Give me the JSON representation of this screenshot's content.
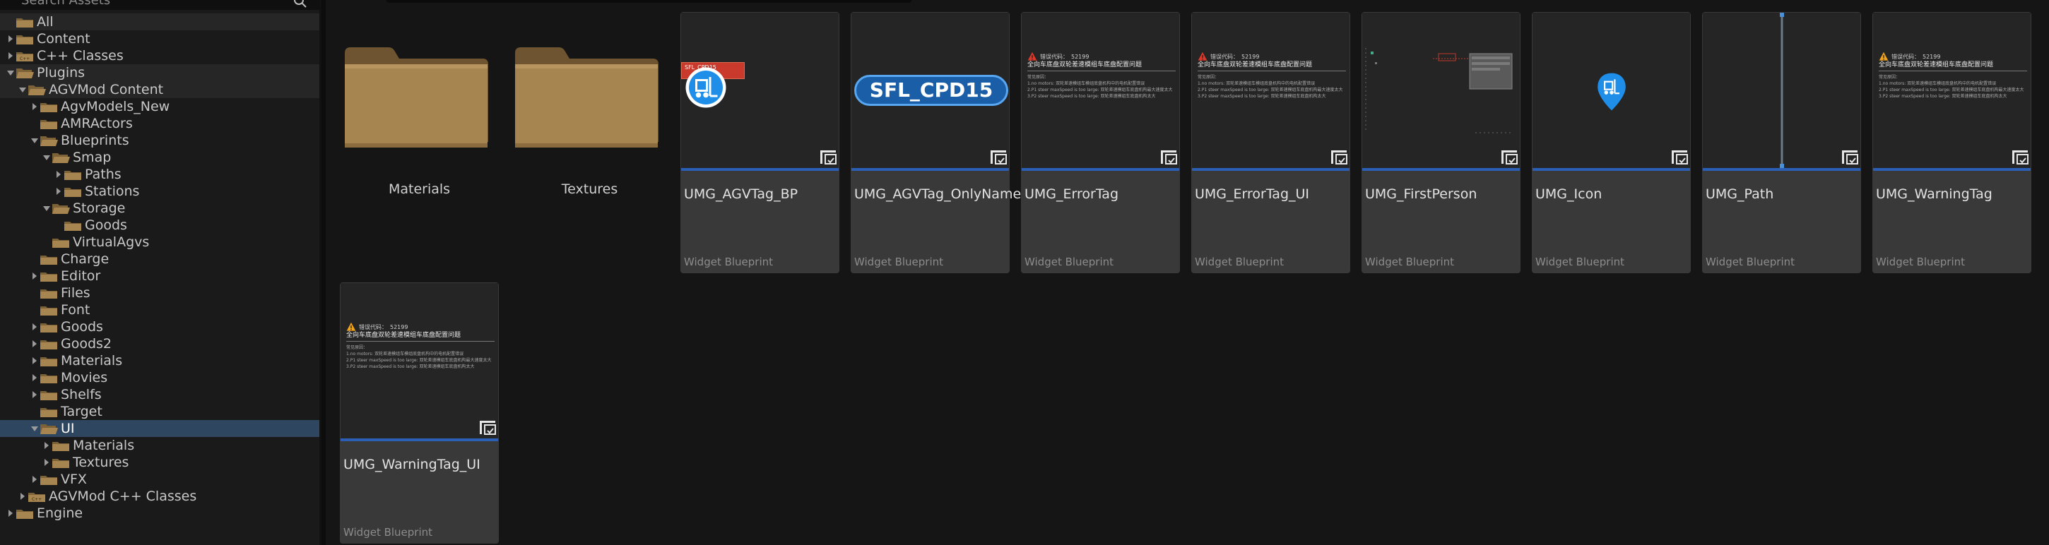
{
  "search": {
    "placeholder": "Search Assets"
  },
  "tree": [
    {
      "label": "All",
      "depth": 0,
      "arrow": "none",
      "state": "hl"
    },
    {
      "label": "Content",
      "depth": 0,
      "arrow": "right",
      "state": ""
    },
    {
      "label": "C++ Classes",
      "depth": 0,
      "arrow": "right",
      "state": "",
      "folder": "cpp"
    },
    {
      "label": "Plugins",
      "depth": 0,
      "arrow": "down",
      "state": "hl"
    },
    {
      "label": "AGVMod Content",
      "depth": 1,
      "arrow": "down",
      "state": "hl"
    },
    {
      "label": "AgvModels_New",
      "depth": 2,
      "arrow": "right",
      "state": ""
    },
    {
      "label": "AMRActors",
      "depth": 2,
      "arrow": "none",
      "state": ""
    },
    {
      "label": "Blueprints",
      "depth": 2,
      "arrow": "down",
      "state": ""
    },
    {
      "label": "Smap",
      "depth": 3,
      "arrow": "down",
      "state": ""
    },
    {
      "label": "Paths",
      "depth": 4,
      "arrow": "right",
      "state": ""
    },
    {
      "label": "Stations",
      "depth": 4,
      "arrow": "right",
      "state": ""
    },
    {
      "label": "Storage",
      "depth": 3,
      "arrow": "down",
      "state": ""
    },
    {
      "label": "Goods",
      "depth": 4,
      "arrow": "none",
      "state": ""
    },
    {
      "label": "VirtualAgvs",
      "depth": 3,
      "arrow": "none",
      "state": ""
    },
    {
      "label": "Charge",
      "depth": 2,
      "arrow": "none",
      "state": ""
    },
    {
      "label": "Editor",
      "depth": 2,
      "arrow": "right",
      "state": ""
    },
    {
      "label": "Files",
      "depth": 2,
      "arrow": "none",
      "state": ""
    },
    {
      "label": "Font",
      "depth": 2,
      "arrow": "none",
      "state": ""
    },
    {
      "label": "Goods",
      "depth": 2,
      "arrow": "right",
      "state": ""
    },
    {
      "label": "Goods2",
      "depth": 2,
      "arrow": "right",
      "state": ""
    },
    {
      "label": "Materials",
      "depth": 2,
      "arrow": "right",
      "state": ""
    },
    {
      "label": "Movies",
      "depth": 2,
      "arrow": "right",
      "state": ""
    },
    {
      "label": "Shelfs",
      "depth": 2,
      "arrow": "right",
      "state": ""
    },
    {
      "label": "Target",
      "depth": 2,
      "arrow": "none",
      "state": ""
    },
    {
      "label": "UI",
      "depth": 2,
      "arrow": "down",
      "state": "sel"
    },
    {
      "label": "Materials",
      "depth": 3,
      "arrow": "right",
      "state": ""
    },
    {
      "label": "Textures",
      "depth": 3,
      "arrow": "right",
      "state": ""
    },
    {
      "label": "VFX",
      "depth": 2,
      "arrow": "right",
      "state": ""
    },
    {
      "label": "AGVMod C++ Classes",
      "depth": 1,
      "arrow": "right",
      "state": "",
      "folder": "cpp"
    },
    {
      "label": "Engine",
      "depth": 0,
      "arrow": "right",
      "state": ""
    }
  ],
  "folders": [
    {
      "label": "Materials"
    },
    {
      "label": "Textures"
    }
  ],
  "assets": [
    {
      "name": "UMG_AGVTag_BP",
      "type": "Widget Blueprint",
      "thumb": "agvtag"
    },
    {
      "name": "UMG_AGVTag_OnlyName",
      "type": "Widget Blueprint",
      "thumb": "pill",
      "pill_text": "SFL_CPD15"
    },
    {
      "name": "UMG_ErrorTag",
      "type": "Widget Blueprint",
      "thumb": "error"
    },
    {
      "name": "UMG_ErrorTag_UI",
      "type": "Widget Blueprint",
      "thumb": "error"
    },
    {
      "name": "UMG_FirstPerson",
      "type": "Widget Blueprint",
      "thumb": "firstperson"
    },
    {
      "name": "UMG_Icon",
      "type": "Widget Blueprint",
      "thumb": "icon"
    },
    {
      "name": "UMG_Path",
      "type": "Widget Blueprint",
      "thumb": "path"
    },
    {
      "name": "UMG_WarningTag",
      "type": "Widget Blueprint",
      "thumb": "warning"
    },
    {
      "name": "UMG_WarningTag_UI",
      "type": "Widget Blueprint",
      "thumb": "warning"
    }
  ],
  "preview_text": {
    "code_label": "错误代码：",
    "code_value": "52199",
    "title": "全向车底盘双轮差速模组车底盘配置问题",
    "reason_label": "常见原因：",
    "reason_lines": [
      "1.no motors: 双轮差速模组车模组底盘机构中的电机配置错误",
      "2.P1 steer maxSpeed is too large: 双轮差速模组车底盘机构最大速度太大",
      "3.P2 steer maxSpeed is too large: 双轮差速模组车底盘机构太大"
    ],
    "tag_badge": "SFL_CPD15"
  },
  "colors": {
    "accent": "#2a5fb5",
    "folder": "#a78550",
    "selection": "#2f4660",
    "warning": "#f2a31b",
    "error": "#e0392b",
    "agv_blue": "#1f8ee8"
  }
}
